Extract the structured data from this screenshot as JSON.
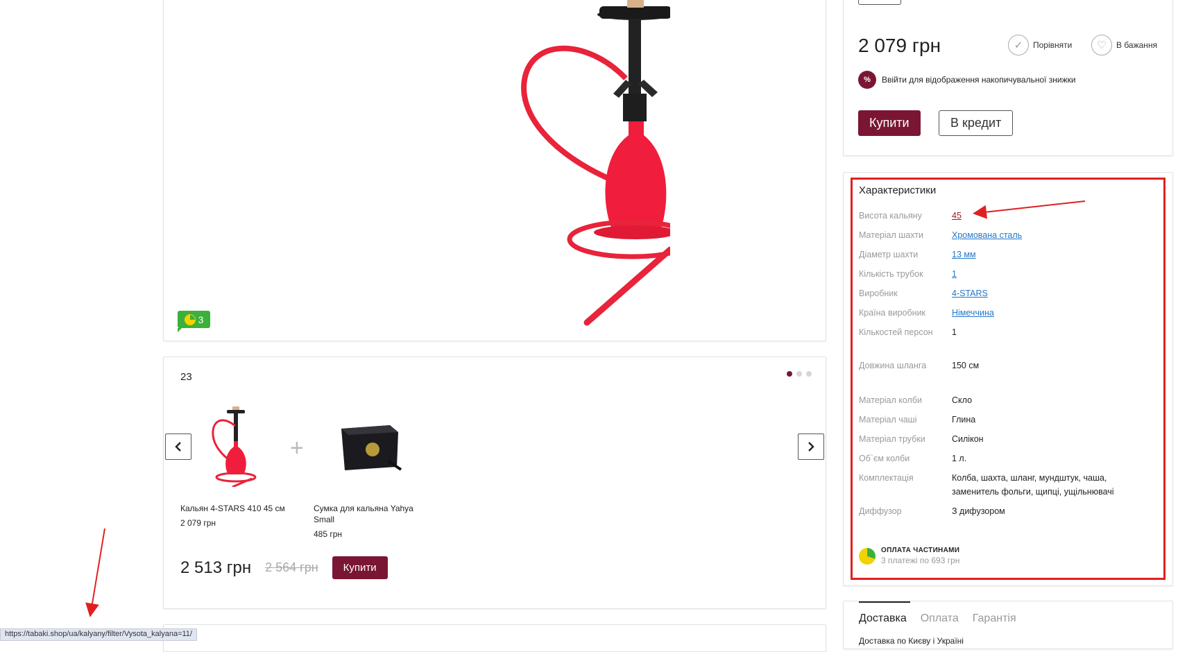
{
  "review_count": "3",
  "bundle": {
    "title": "23",
    "items": [
      {
        "name": "Кальян 4-STARS 410 45 см",
        "price": "2 079 грн"
      },
      {
        "name": "Сумка для кальяна Yahya Small",
        "price": "485 грн"
      }
    ],
    "total_price": "2 513 грн",
    "old_price": "2 564 грн",
    "buy_label": "Купити"
  },
  "product": {
    "price": "2 079 грн",
    "compare_label": "Порівняти",
    "wishlist_label": "В бажання",
    "discount_badge": "%",
    "discount_text": "Ввійти для відображення накопичувальної знижки",
    "buy_label": "Купити",
    "credit_label": "В кредит"
  },
  "specs": {
    "title": "Характеристики",
    "rows": [
      {
        "label": "Висота кальяну",
        "value": "45"
      },
      {
        "label": "Матеріал шахти",
        "value": "Хромована сталь"
      },
      {
        "label": "Діаметр шахти",
        "value": "13 мм"
      },
      {
        "label": "Кількість трубок",
        "value": "1"
      },
      {
        "label": "Виробник",
        "value": "4-STARS"
      },
      {
        "label": "Країна виробник",
        "value": "Німеччина"
      },
      {
        "label": "Кількостей персон",
        "value": "1"
      },
      {
        "label": "Довжина шланга",
        "value": "150 см"
      },
      {
        "label": "Матеріал колби",
        "value": "Скло"
      },
      {
        "label": "Матеріал чаші",
        "value": "Глина"
      },
      {
        "label": "Матеріал трубки",
        "value": "Силікон"
      },
      {
        "label": "Об`єм колби",
        "value": "1 л."
      },
      {
        "label": "Комплектація",
        "value": "Колба, шахта, шланг, мундштук, чаша, заменитель фольги, щипці, ущільнювачі"
      },
      {
        "label": "Диффузор",
        "value": "З дифузором"
      }
    ],
    "installments_title": "ОПЛАТА ЧАСТИНАМИ",
    "installments_sub": "3 платежі по 693 грн"
  },
  "delivery": {
    "tabs": [
      "Доставка",
      "Оплата",
      "Гарантія"
    ],
    "sub": "Доставка по Києву і Україні"
  },
  "status_url": "https://tabaki.shop/ua/kalyany/filter/Vysota_kalyana=11/",
  "colors": {
    "brand": "#7a1634",
    "annotation": "#e02020",
    "link": "#2277cc"
  }
}
